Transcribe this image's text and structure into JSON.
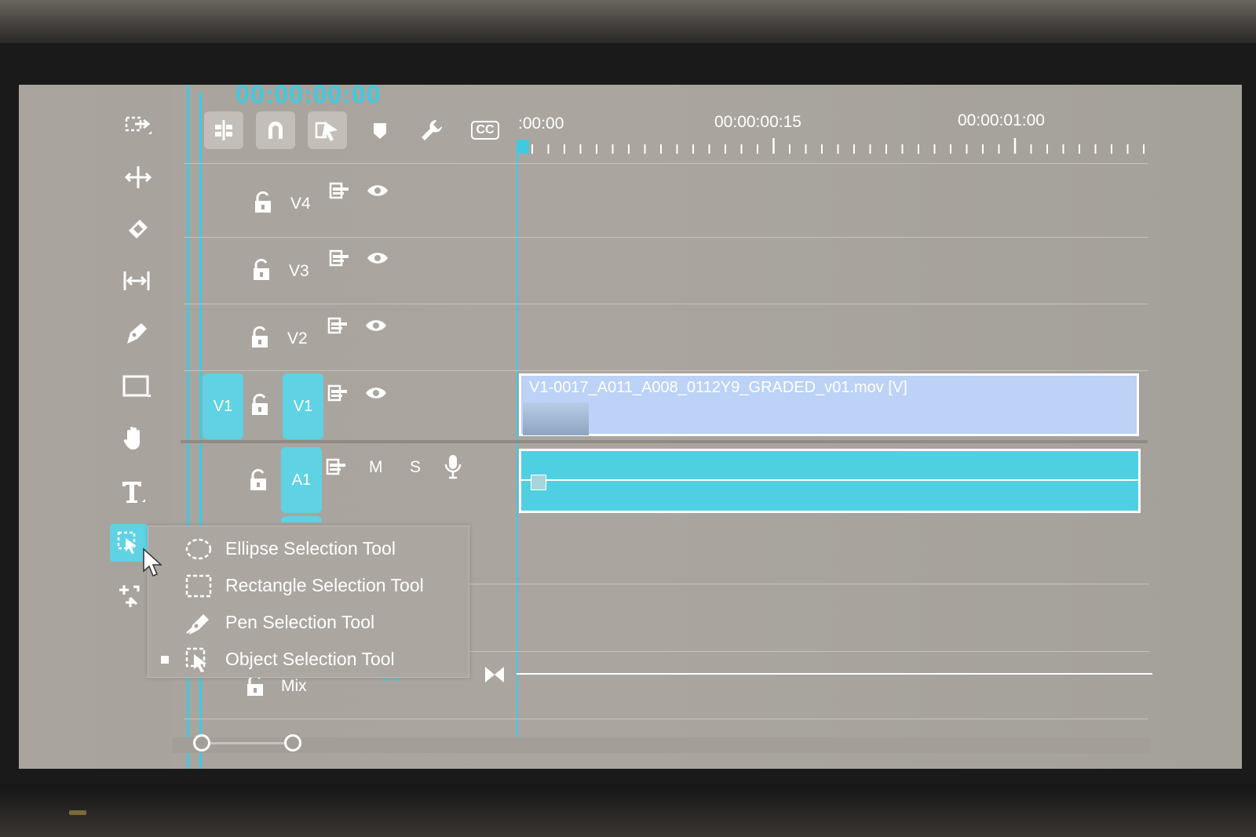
{
  "timecode": "00:00:00:00",
  "toolbar": {
    "icons": [
      "insert-overwrite-icon",
      "snap-magnet-icon",
      "linked-selection-icon",
      "marker-icon",
      "wrench-icon",
      "captions-cc-icon"
    ],
    "cc_label": "CC"
  },
  "ruler": {
    "t0": ":00:00",
    "t1": "00:00:00:15",
    "t2": "00:00:01:00"
  },
  "tracks": {
    "v4": "V4",
    "v3": "V3",
    "v2": "V2",
    "v1_source": "V1",
    "v1": "V1",
    "a1": "A1",
    "mute": "M",
    "solo": "S",
    "mix": "Mix",
    "mix_value": "0.0"
  },
  "clips": {
    "video_name": "V1-0017_A011_A008_0112Y9_GRADED_v01.mov [V]"
  },
  "tools": [
    "track-select-icon",
    "ripple-edit-icon",
    "razor-icon",
    "slip-icon",
    "pen-icon",
    "rectangle-icon",
    "hand-icon",
    "type-icon",
    "object-selection-icon",
    "transform-icon"
  ],
  "tool_menu": {
    "items": [
      {
        "label": "Ellipse Selection Tool",
        "icon": "ellipse-selection-icon",
        "selected": false
      },
      {
        "label": "Rectangle Selection Tool",
        "icon": "rectangle-selection-icon",
        "selected": false
      },
      {
        "label": "Pen Selection Tool",
        "icon": "pen-selection-icon",
        "selected": false
      },
      {
        "label": "Object Selection Tool",
        "icon": "object-selection-icon",
        "selected": true
      }
    ]
  },
  "colors": {
    "accent": "#3ecbe0",
    "video_clip": "#bcd2f6",
    "audio_clip": "#4fd0e2",
    "panel": "#aaa59f"
  }
}
